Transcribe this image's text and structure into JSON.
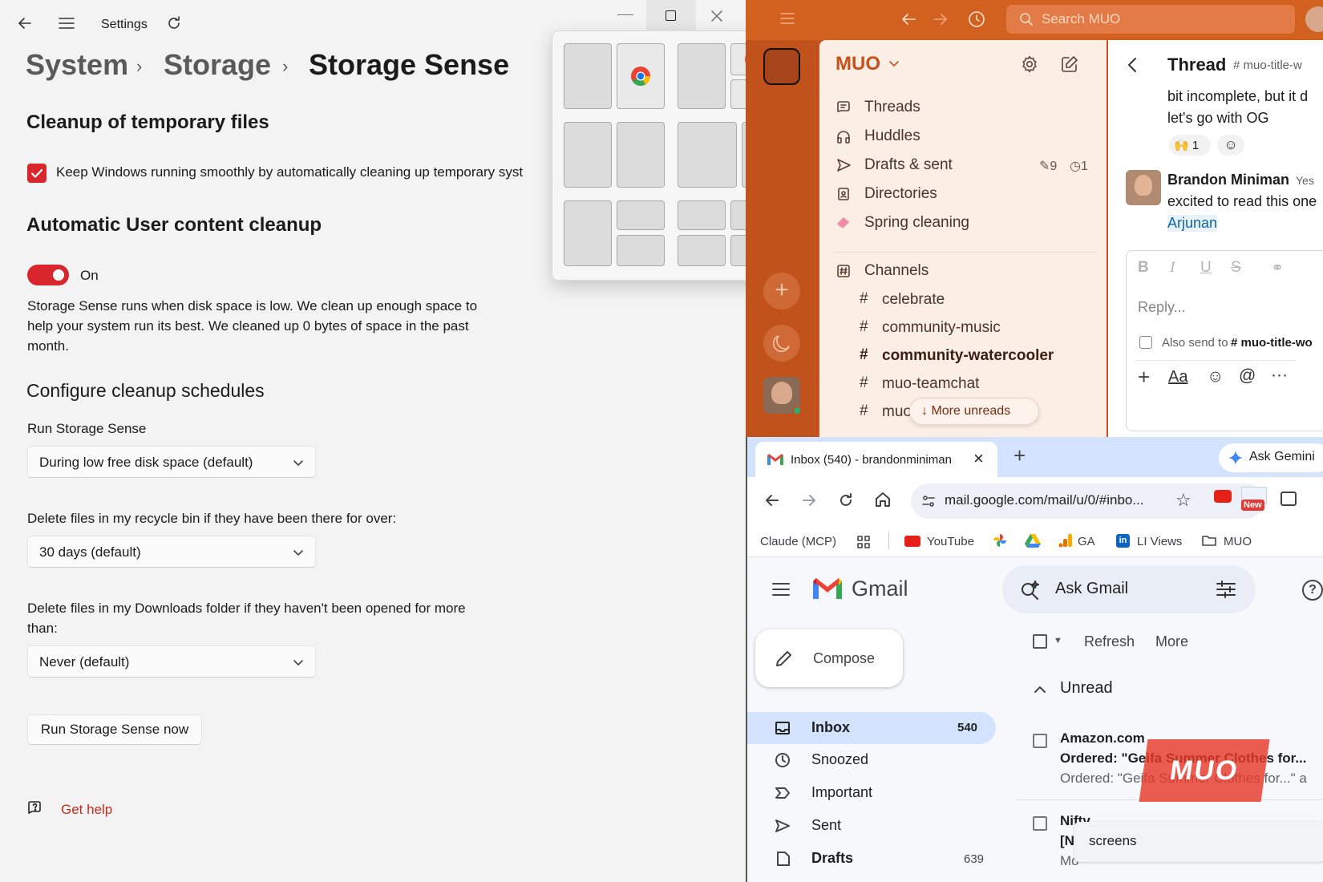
{
  "settings": {
    "app_title": "Settings",
    "breadcrumb": [
      "System",
      "Storage",
      "Storage Sense"
    ],
    "cleanup_heading": "Cleanup of temporary files",
    "keep_running_label": "Keep Windows running smoothly by automatically cleaning up temporary syst",
    "keep_running_checked": true,
    "auto_heading": "Automatic User content cleanup",
    "toggle_state": "On",
    "toggle_on": true,
    "description": "Storage Sense runs when disk space is low. We clean up enough space to help your system run its best. We cleaned up 0 bytes of space in the past month.",
    "schedules_heading": "Configure cleanup schedules",
    "run_label": "Run Storage Sense",
    "run_value": "During low free disk space (default)",
    "recycle_label": "Delete files in my recycle bin if they have been there for over:",
    "recycle_value": "30 days (default)",
    "downloads_label": "Delete files in my Downloads folder if they haven't been opened for more than:",
    "downloads_value": "Never (default)",
    "run_now_button": "Run Storage Sense now",
    "get_help": "Get help",
    "accent_color": "#d8262c"
  },
  "slack": {
    "search_placeholder": "Search MUO",
    "workspace": "MUO",
    "items": [
      {
        "label": "Threads",
        "icon": "threads-icon"
      },
      {
        "label": "Huddles",
        "icon": "headphones-icon"
      },
      {
        "label": "Drafts & sent",
        "icon": "send-icon",
        "badge_drafts": "9",
        "badge_scheduled": "1"
      },
      {
        "label": "Directories",
        "icon": "directory-icon"
      },
      {
        "label": "Spring cleaning",
        "icon": "eraser-icon"
      }
    ],
    "channels_label": "Channels",
    "channels": [
      {
        "name": "celebrate",
        "bold": false
      },
      {
        "name": "community-music",
        "bold": false
      },
      {
        "name": "community-watercooler",
        "bold": true
      },
      {
        "name": "muo-teamchat",
        "bold": false
      },
      {
        "name": "muo-technical",
        "bold": false
      }
    ],
    "more_unreads": "More unreads",
    "thread": {
      "title": "Thread",
      "channel": "# muo-title-w",
      "msg1_line1": "bit incomplete, but it d",
      "msg1_line2": "let's go with OG",
      "reaction_count": "1",
      "author": "Brandon Miniman",
      "author_suffix": "Yes",
      "msg2_line1": "excited to read this one",
      "mention": "Arjunan",
      "reply_placeholder": "Reply...",
      "also_send": "Also send to",
      "also_send_channel": "# muo-title-wo"
    },
    "colors": {
      "rail": "#c1521b",
      "sidebar": "#fbeee5"
    }
  },
  "chrome": {
    "tab_title": "Inbox (540) - brandonminiman",
    "ask_gemini": "Ask Gemini",
    "url": "mail.google.com/mail/u/0/#inbo...",
    "new_badge": "New",
    "bookmarks": [
      "Claude (MCP)",
      "YouTube",
      "GA",
      "LI Views",
      "MUO"
    ]
  },
  "gmail": {
    "logo_text": "Gmail",
    "search_placeholder": "Ask Gmail",
    "compose": "Compose",
    "refresh": "Refresh",
    "more": "More",
    "section": "Unread",
    "nav": [
      {
        "label": "Inbox",
        "count": "540",
        "bold": true
      },
      {
        "label": "Snoozed",
        "count": "",
        "bold": false
      },
      {
        "label": "Important",
        "count": "",
        "bold": false
      },
      {
        "label": "Sent",
        "count": "",
        "bold": false
      },
      {
        "label": "Drafts",
        "count": "639",
        "bold": true
      }
    ],
    "emails": [
      {
        "sender": "Amazon.com",
        "subject": "Ordered: \"Geifa Summer Clothes for...",
        "snippet": "Ordered: \"Geifa Summer Clothes for...\" a"
      },
      {
        "sender": "Niftv",
        "subject": "[N",
        "snippet": "Mo"
      }
    ],
    "tooltip": "screens"
  },
  "watermark": "MUO"
}
